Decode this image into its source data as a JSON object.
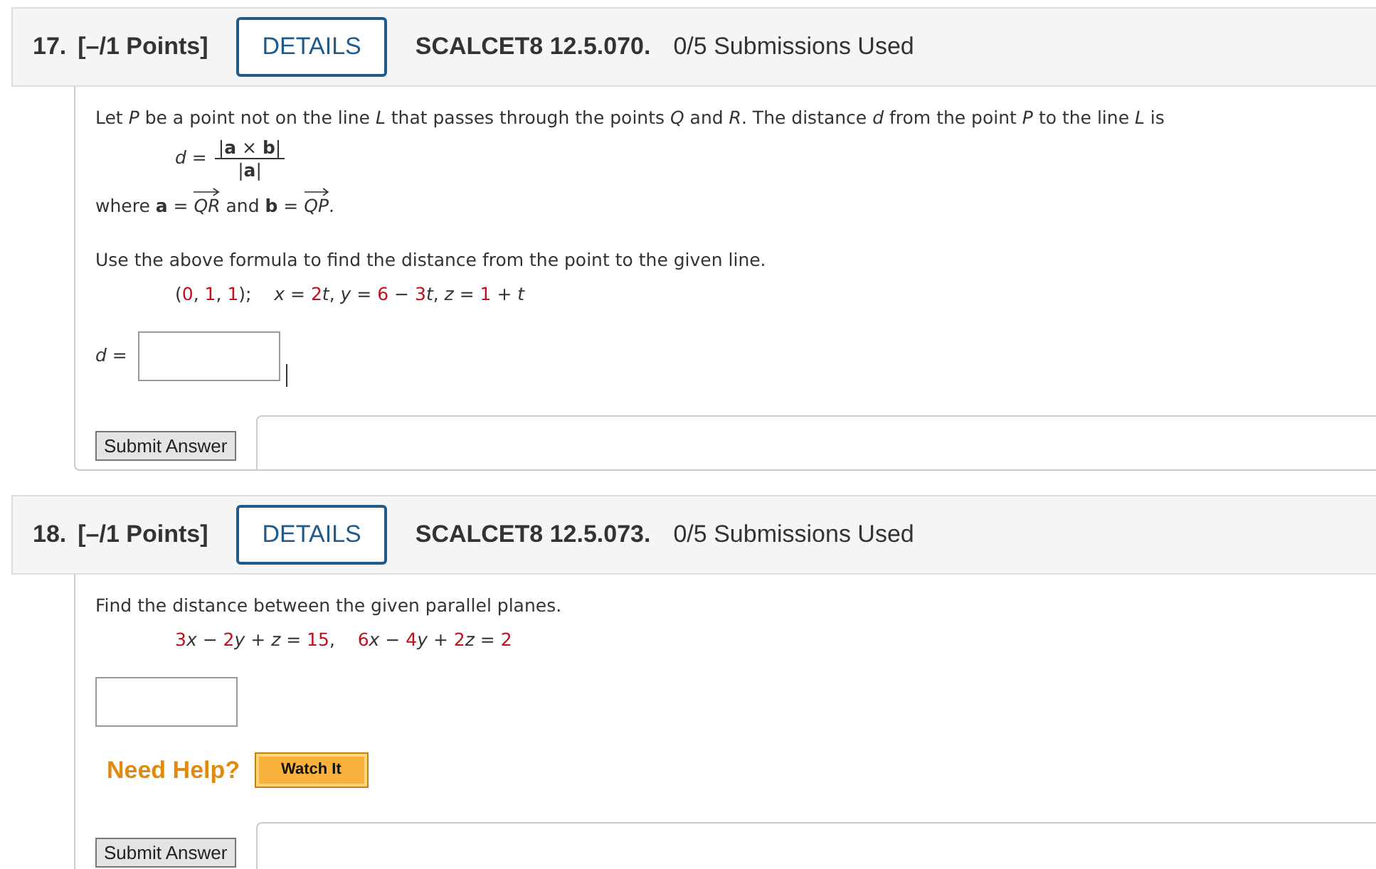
{
  "questions": [
    {
      "number": "17.",
      "points": "[–/1 Points]",
      "details_button": "DETAILS",
      "source": "SCALCET8 12.5.070.",
      "submissions": "0/5 Submissions Used",
      "submit_button": "Submit Answer",
      "body": [
        {
          "kind": "paragraph",
          "text": "Let *P* be a point not on the line *L* that passes through the points *Q* and *R*. The distance *d* from the point *P* to the line *L* is"
        },
        {
          "kind": "fraction",
          "lhs": "*d* =",
          "numerator": "|**a** × **b**|",
          "denominator": "|**a**|"
        },
        {
          "kind": "tokens",
          "tokens": [
            {
              "kind": "text",
              "text": "where "
            },
            {
              "kind": "bold",
              "text": "a"
            },
            {
              "kind": "text",
              "text": " = "
            },
            {
              "kind": "vector",
              "text": "QR"
            },
            {
              "kind": "text",
              "text": " and "
            },
            {
              "kind": "bold",
              "text": "b"
            },
            {
              "kind": "text",
              "text": " = "
            },
            {
              "kind": "vector",
              "text": "QP"
            },
            {
              "kind": "text",
              "text": "."
            }
          ]
        },
        {
          "kind": "paragraph",
          "text": "Use the above formula to find the distance from the point to the given line."
        },
        {
          "kind": "equation",
          "tokens": [
            {
              "kind": "op",
              "text": "("
            },
            {
              "kind": "num",
              "text": "0"
            },
            {
              "kind": "op",
              "text": ", "
            },
            {
              "kind": "num",
              "text": "1"
            },
            {
              "kind": "op",
              "text": ", "
            },
            {
              "kind": "num",
              "text": "1"
            },
            {
              "kind": "op",
              "text": ");    "
            },
            {
              "kind": "var",
              "text": "x"
            },
            {
              "kind": "op",
              "text": " = "
            },
            {
              "kind": "num",
              "text": "2"
            },
            {
              "kind": "var",
              "text": "t"
            },
            {
              "kind": "op",
              "text": ", "
            },
            {
              "kind": "var",
              "text": "y"
            },
            {
              "kind": "op",
              "text": " = "
            },
            {
              "kind": "num",
              "text": "6"
            },
            {
              "kind": "op",
              "text": " − "
            },
            {
              "kind": "num",
              "text": "3"
            },
            {
              "kind": "var",
              "text": "t"
            },
            {
              "kind": "op",
              "text": ", "
            },
            {
              "kind": "var",
              "text": "z"
            },
            {
              "kind": "op",
              "text": " = "
            },
            {
              "kind": "num",
              "text": "1"
            },
            {
              "kind": "op",
              "text": " + "
            },
            {
              "kind": "var",
              "text": "t"
            }
          ]
        },
        {
          "kind": "answer",
          "label": "*d* =",
          "cursor": true
        }
      ]
    },
    {
      "number": "18.",
      "points": "[–/1 Points]",
      "details_button": "DETAILS",
      "source": "SCALCET8 12.5.073.",
      "submissions": "0/5 Submissions Used",
      "submit_button": "Submit Answer",
      "body": [
        {
          "kind": "paragraph",
          "text": "Find the distance between the given parallel planes."
        },
        {
          "kind": "equation",
          "tokens": [
            {
              "kind": "num",
              "text": "3"
            },
            {
              "kind": "var",
              "text": "x"
            },
            {
              "kind": "op",
              "text": " − "
            },
            {
              "kind": "num",
              "text": "2"
            },
            {
              "kind": "var",
              "text": "y"
            },
            {
              "kind": "op",
              "text": " + "
            },
            {
              "kind": "var",
              "text": "z"
            },
            {
              "kind": "op",
              "text": " = "
            },
            {
              "kind": "num",
              "text": "15"
            },
            {
              "kind": "op",
              "text": ",    "
            },
            {
              "kind": "num",
              "text": "6"
            },
            {
              "kind": "var",
              "text": "x"
            },
            {
              "kind": "op",
              "text": " − "
            },
            {
              "kind": "num",
              "text": "4"
            },
            {
              "kind": "var",
              "text": "y"
            },
            {
              "kind": "op",
              "text": " + "
            },
            {
              "kind": "num",
              "text": "2"
            },
            {
              "kind": "var",
              "text": "z"
            },
            {
              "kind": "op",
              "text": " = "
            },
            {
              "kind": "num",
              "text": "2"
            }
          ]
        },
        {
          "kind": "answer",
          "cursor": false
        },
        {
          "kind": "help",
          "label": "Need Help?",
          "button": "Watch It"
        }
      ]
    }
  ]
}
